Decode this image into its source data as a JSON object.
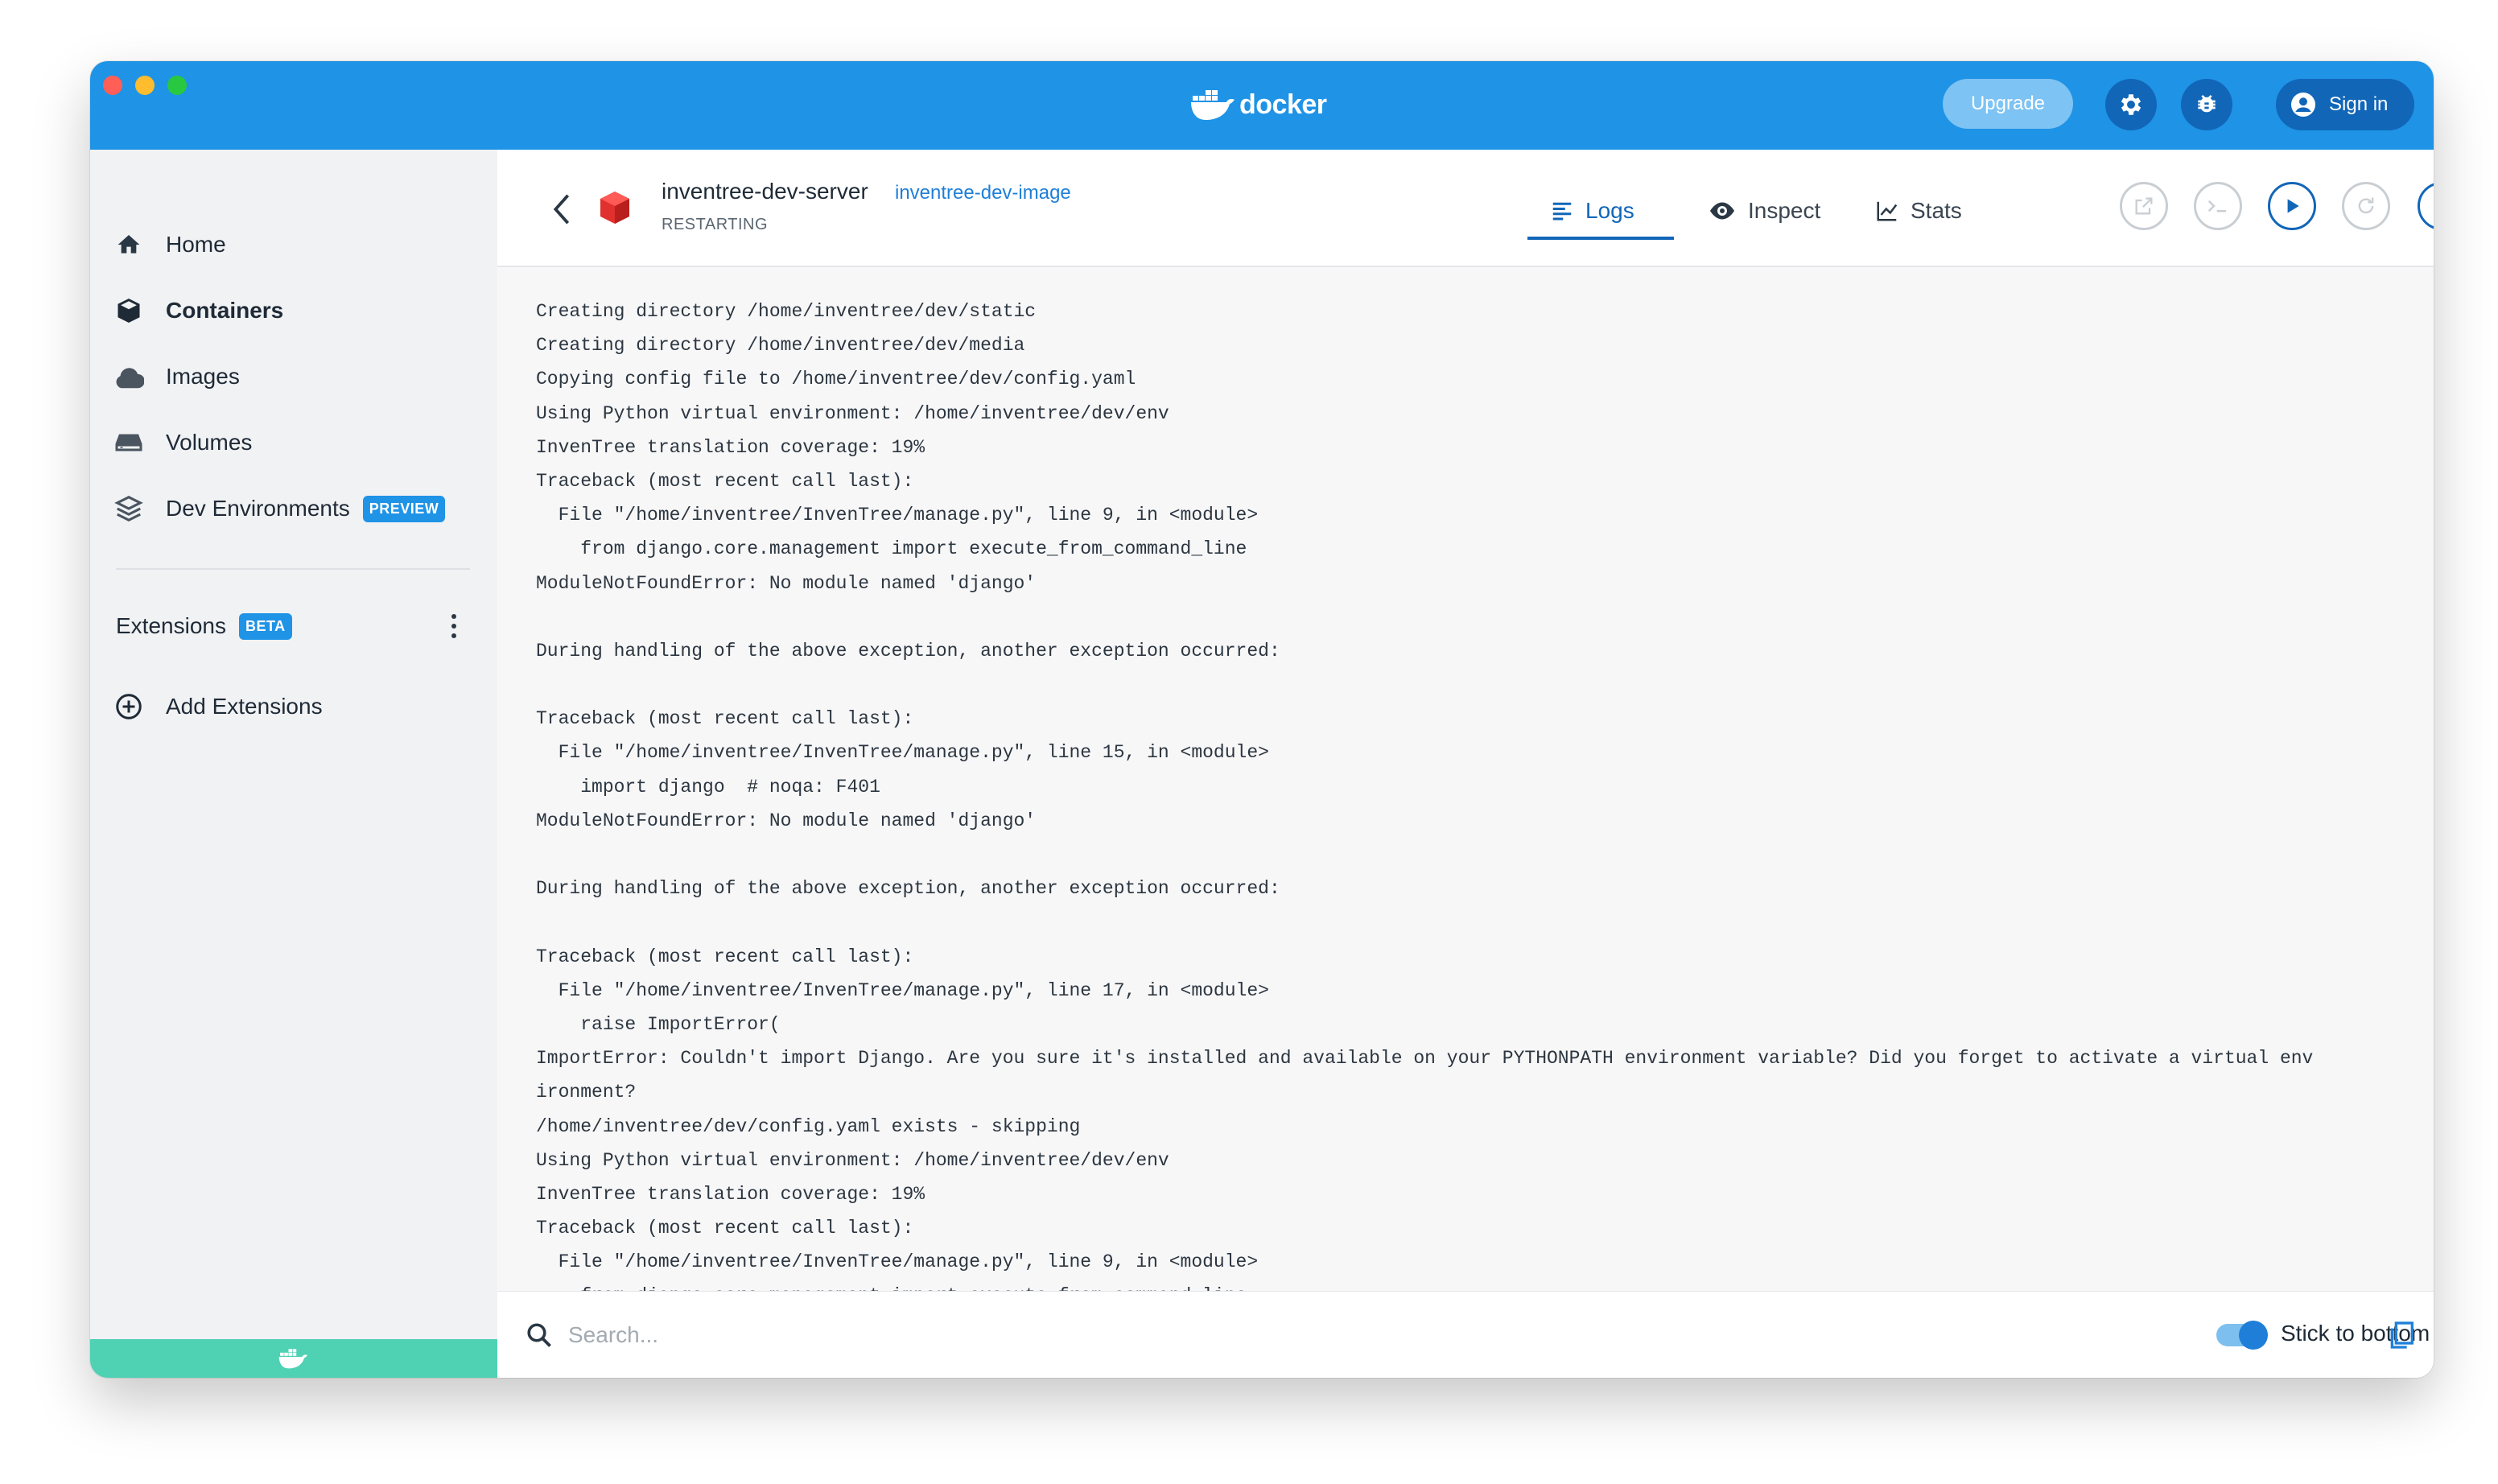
{
  "app": {
    "brand": "docker",
    "upgrade_label": "Upgrade",
    "signin_label": "Sign in"
  },
  "sidebar": {
    "items": [
      {
        "label": "Home",
        "icon": "home-icon"
      },
      {
        "label": "Containers",
        "icon": "containers-icon",
        "active": true
      },
      {
        "label": "Images",
        "icon": "cloud-icon"
      },
      {
        "label": "Volumes",
        "icon": "volume-icon"
      },
      {
        "label": "Dev Environments",
        "icon": "dev-env-icon",
        "badge": "PREVIEW"
      }
    ],
    "extensions_label": "Extensions",
    "extensions_badge": "BETA",
    "add_extensions_label": "Add Extensions"
  },
  "container": {
    "name": "inventree-dev-server",
    "image": "inventree-dev-image",
    "status": "RESTARTING"
  },
  "tabs": [
    {
      "label": "Logs",
      "icon": "logs-icon",
      "active": true
    },
    {
      "label": "Inspect",
      "icon": "eye-icon"
    },
    {
      "label": "Stats",
      "icon": "chart-icon"
    }
  ],
  "logs": [
    "Creating directory /home/inventree/dev/static",
    "Creating directory /home/inventree/dev/media",
    "Copying config file to /home/inventree/dev/config.yaml",
    "Using Python virtual environment: /home/inventree/dev/env",
    "InvenTree translation coverage: 19%",
    "Traceback (most recent call last):",
    "  File \"/home/inventree/InvenTree/manage.py\", line 9, in <module>",
    "    from django.core.management import execute_from_command_line",
    "ModuleNotFoundError: No module named 'django'",
    "",
    "During handling of the above exception, another exception occurred:",
    "",
    "Traceback (most recent call last):",
    "  File \"/home/inventree/InvenTree/manage.py\", line 15, in <module>",
    "    import django  # noqa: F401",
    "ModuleNotFoundError: No module named 'django'",
    "",
    "During handling of the above exception, another exception occurred:",
    "",
    "Traceback (most recent call last):",
    "  File \"/home/inventree/InvenTree/manage.py\", line 17, in <module>",
    "    raise ImportError(",
    "ImportError: Couldn't import Django. Are you sure it's installed and available on your PYTHONPATH environment variable? Did you forget to activate a virtual env",
    "ironment?",
    "/home/inventree/dev/config.yaml exists - skipping",
    "Using Python virtual environment: /home/inventree/dev/env",
    "InvenTree translation coverage: 19%",
    "Traceback (most recent call last):",
    "  File \"/home/inventree/InvenTree/manage.py\", line 9, in <module>",
    "    from django.core.management import execute_from_command_line"
  ],
  "footer": {
    "search_placeholder": "Search...",
    "stick_to_bottom_label": "Stick to bottom",
    "stick_to_bottom": true
  },
  "colors": {
    "brand_blue": "#1f93e6",
    "dark_blue": "#1166b8",
    "status_teal": "#4fd1b4",
    "container_red": "#e0312e"
  }
}
